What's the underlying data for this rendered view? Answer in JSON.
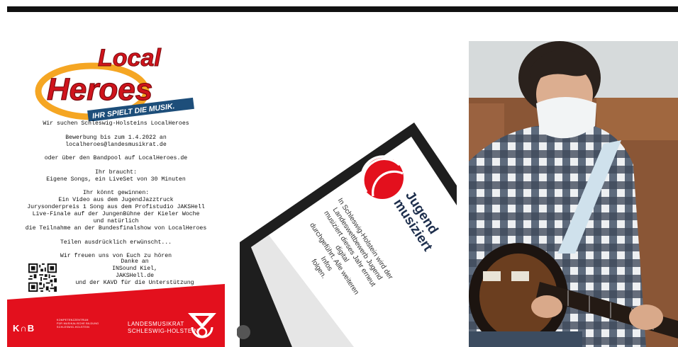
{
  "flyer": {
    "logo_word1": "Local",
    "logo_word2": "Heroes",
    "logo_tagline": "IHR SPIELT DIE MUSIK.",
    "text_lines": [
      [
        "Wir suchen Schleswig-Holsteins LocalHeroes"
      ],
      [
        "Bewerbung bis zum 1.4.2022 an",
        "localheroes@landesmusikrat.de"
      ],
      [
        "oder über den Bandpool auf LocalHeroes.de"
      ],
      [
        "Ihr braucht:",
        "Eigene Songs, ein LiveSet von 30 Minuten"
      ],
      [
        "Ihr könnt gewinnen:",
        "Ein Video aus dem JugendJazztruck",
        "Jurysonderpreis 1 Song aus dem Profistudio JAKSHell",
        "Live-Finale auf der JungenBühne der Kieler Woche",
        "und natürlich",
        "die Teilnahme an der Bundesfinalshow von LocalHeroes"
      ],
      [
        "Teilen ausdrücklich erwünscht..."
      ],
      [
        "Wir freuen uns von Euch zu hören"
      ]
    ],
    "thanks_lines": [
      "Danke an",
      "INSound Kiel,",
      "JAKSHell.de",
      "und der KAVD für die Unterstützung"
    ],
    "kmb_logo": "K∩B",
    "kmb_sub_lines": [
      "KOMPETENZZENTRUM",
      "FÜR MUSIKALISCHE BILDUNG",
      "SCHLESWIG-HOLSTEIN"
    ],
    "lmr_lines": [
      "LANDESMUSIKRAT",
      "SCHLESWIG-HOLSTEIN"
    ]
  },
  "phone": {
    "title_lines": [
      "Jugend",
      "musiziert"
    ],
    "body_lines": [
      "In Schleswig-Holstein wird der",
      "Landeswettbewerb Jugend",
      "musiziert dieses Jahr erneut digital",
      "durchgeführt. Alle weiteren Infos",
      "folgen."
    ]
  },
  "colors": {
    "red": "#e3101d",
    "navy": "#1d2e4c",
    "orange": "#f5a623"
  }
}
